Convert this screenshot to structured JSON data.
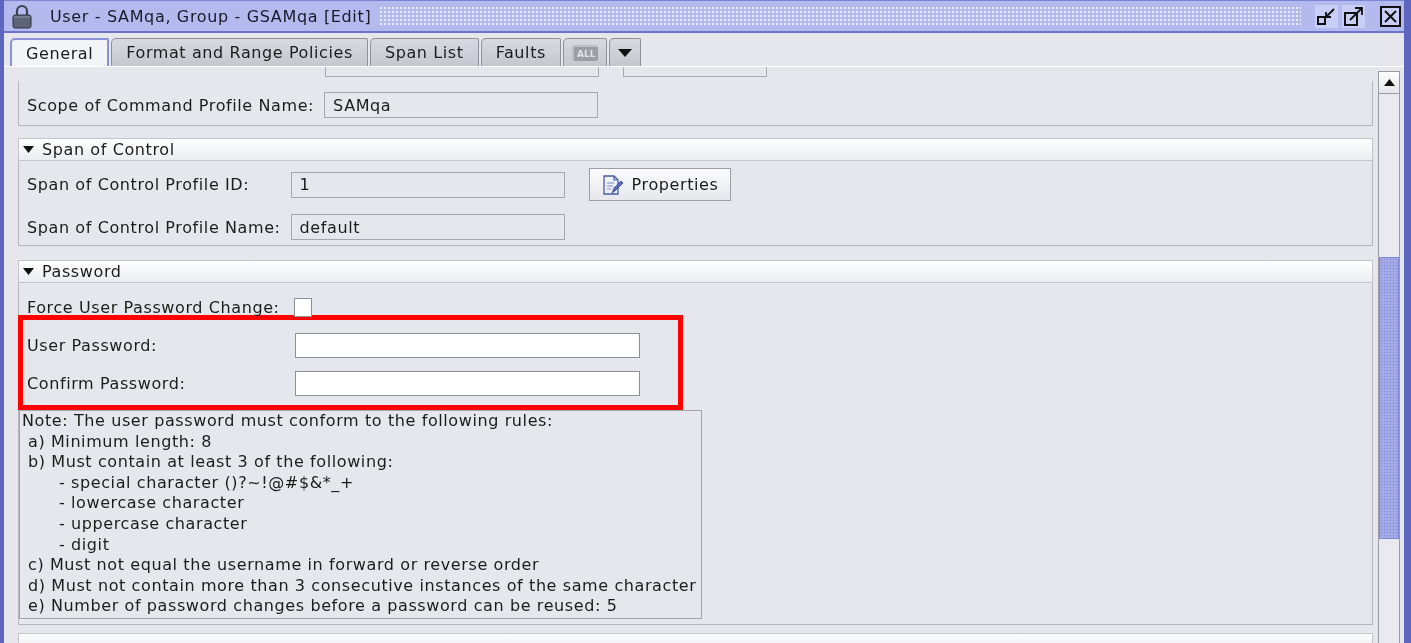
{
  "window": {
    "title": "User - SAMqa, Group - GSAMqa [Edit]"
  },
  "tabs": [
    {
      "kind": "text",
      "label": "General",
      "selected": true,
      "disabled": false
    },
    {
      "kind": "text",
      "label": "Format and Range Policies",
      "selected": false,
      "disabled": false
    },
    {
      "kind": "text",
      "label": "Span List",
      "selected": false,
      "disabled": false
    },
    {
      "kind": "text",
      "label": "Faults",
      "selected": false,
      "disabled": false
    },
    {
      "kind": "icon",
      "label": "ALL",
      "selected": false,
      "disabled": true
    },
    {
      "kind": "menu",
      "selected": false,
      "disabled": false
    }
  ],
  "command_profile": {
    "rows": [
      {
        "kind": "text_field",
        "label": "Scope of Command Profile Name:",
        "value": "SAMqa",
        "editable": false
      }
    ]
  },
  "sections": [
    {
      "title": "Span of Control",
      "expanded": true,
      "rows": [
        {
          "kind": "text_field",
          "label": "Span of Control Profile ID:",
          "value": "1",
          "editable": false,
          "button": "Properties"
        },
        {
          "kind": "text_field",
          "label": "Span of Control Profile Name:",
          "value": "default",
          "editable": false
        }
      ]
    },
    {
      "title": "Password",
      "expanded": true,
      "rows": [
        {
          "kind": "checkbox",
          "label": "Force User Password Change:",
          "checked": false,
          "highlighted": false
        },
        {
          "kind": "text_field",
          "label": "User Password:",
          "editable": true,
          "highlighted": true
        },
        {
          "kind": "text_field",
          "label": "Confirm Password:",
          "editable": true,
          "highlighted": true
        }
      ],
      "note": {
        "lines": [
          {
            "text": "Note: The user password must conform to the following rules:",
            "children": [
              {
                "text": "a) Minimum length: 8"
              },
              {
                "text": "b) Must contain at least 3 of the following:",
                "children": [
                  {
                    "text": "- special character ()?~!@#$&*_+"
                  },
                  {
                    "text": "- lowercase character"
                  },
                  {
                    "text": "- uppercase character"
                  },
                  {
                    "text": "- digit"
                  }
                ]
              },
              {
                "text": "c) Must not equal the username in forward or reverse order"
              },
              {
                "text": "d) Must not contain more than 3 consecutive instances of the same character"
              },
              {
                "text": "e) Number of password changes before a password can be reused: 5"
              }
            ]
          }
        ]
      }
    }
  ]
}
